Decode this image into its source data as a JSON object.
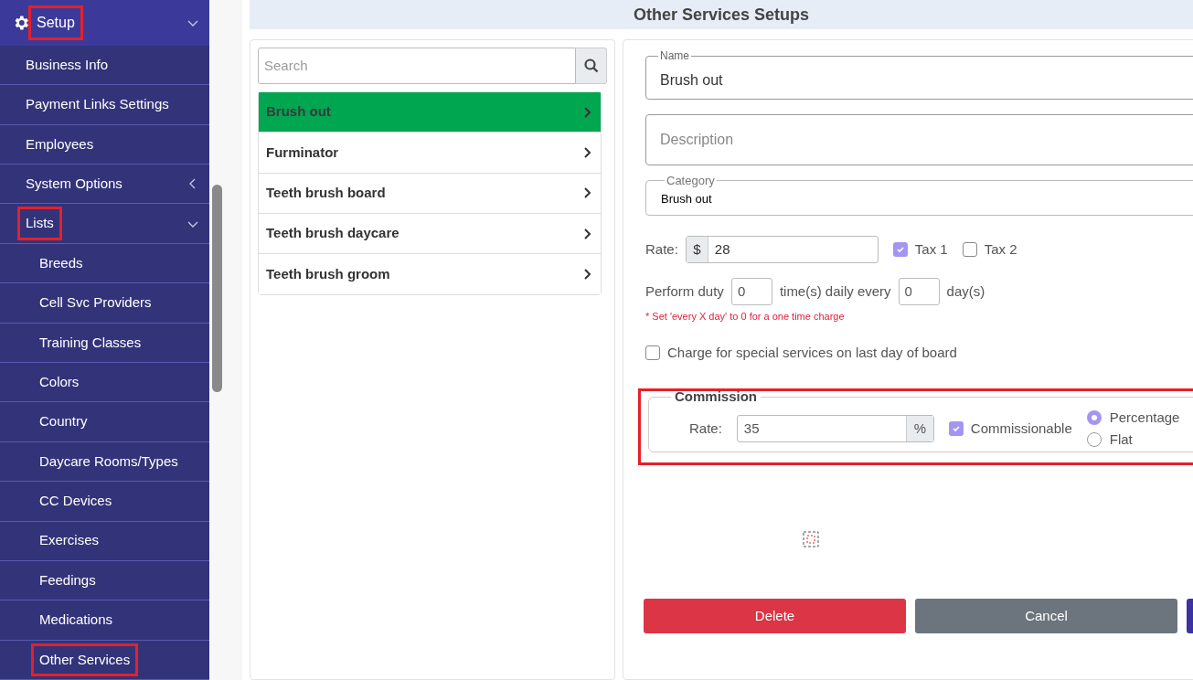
{
  "sidebar": {
    "items": [
      {
        "label": "Setup",
        "expanded": true,
        "highlighted": true,
        "children": [
          {
            "label": "Business Info",
            "highlighted": false
          },
          {
            "label": "Payment Links Settings",
            "highlighted": false
          },
          {
            "label": "Employees",
            "highlighted": false
          },
          {
            "label": "System Options",
            "expanded": false,
            "highlighted": false
          },
          {
            "label": "Lists",
            "expanded": true,
            "highlighted": true,
            "children": [
              {
                "label": "Breeds",
                "highlighted": false
              },
              {
                "label": "Cell Svc Providers",
                "highlighted": false
              },
              {
                "label": "Training Classes",
                "highlighted": false
              },
              {
                "label": "Colors",
                "highlighted": false
              },
              {
                "label": "Country",
                "highlighted": false
              },
              {
                "label": "Daycare Rooms/Types",
                "highlighted": false
              },
              {
                "label": "CC Devices",
                "highlighted": false
              },
              {
                "label": "Exercises",
                "highlighted": false
              },
              {
                "label": "Feedings",
                "highlighted": false
              },
              {
                "label": "Medications",
                "highlighted": false
              },
              {
                "label": "Other Services",
                "highlighted": true
              }
            ]
          }
        ]
      }
    ]
  },
  "page_title": "Other Services Setups",
  "service_list": {
    "search": {
      "placeholder": "Search"
    },
    "items": [
      {
        "label": "Brush out",
        "selected": true
      },
      {
        "label": "Furminator",
        "selected": false
      },
      {
        "label": "Teeth brush board",
        "selected": false
      },
      {
        "label": "Teeth brush daycare",
        "selected": false
      },
      {
        "label": "Teeth brush groom",
        "selected": false
      }
    ]
  },
  "form": {
    "name": {
      "label": "Name",
      "value": "Brush out"
    },
    "description": {
      "placeholder": "Description"
    },
    "category": {
      "label": "Category",
      "value": "Brush out"
    },
    "rate": {
      "label": "Rate:",
      "prefix": "$",
      "value": "28"
    },
    "taxes": [
      {
        "label": "Tax 1",
        "checked": true
      },
      {
        "label": "Tax 2",
        "checked": false
      }
    ],
    "duty": {
      "label": "Perform duty",
      "times": "0",
      "middle": "time(s) daily every",
      "days": "0",
      "suffix": "day(s)",
      "note": "* Set 'every X day' to 0 for a one time charge"
    },
    "last_day": {
      "label": "Charge for special services on last day of board",
      "checked": false
    },
    "commission": {
      "legend": "Commission",
      "highlighted": true,
      "rate_label": "Rate:",
      "rate": "35",
      "suffix": "%",
      "commissionable": {
        "label": "Commissionable",
        "checked": true
      },
      "types": [
        {
          "label": "Percentage",
          "selected": true
        },
        {
          "label": "Flat",
          "selected": false
        }
      ]
    },
    "buttons": [
      {
        "label": "Delete",
        "kind": "danger"
      },
      {
        "label": "Cancel",
        "kind": "secondary"
      },
      {
        "kind": "primary"
      }
    ]
  }
}
